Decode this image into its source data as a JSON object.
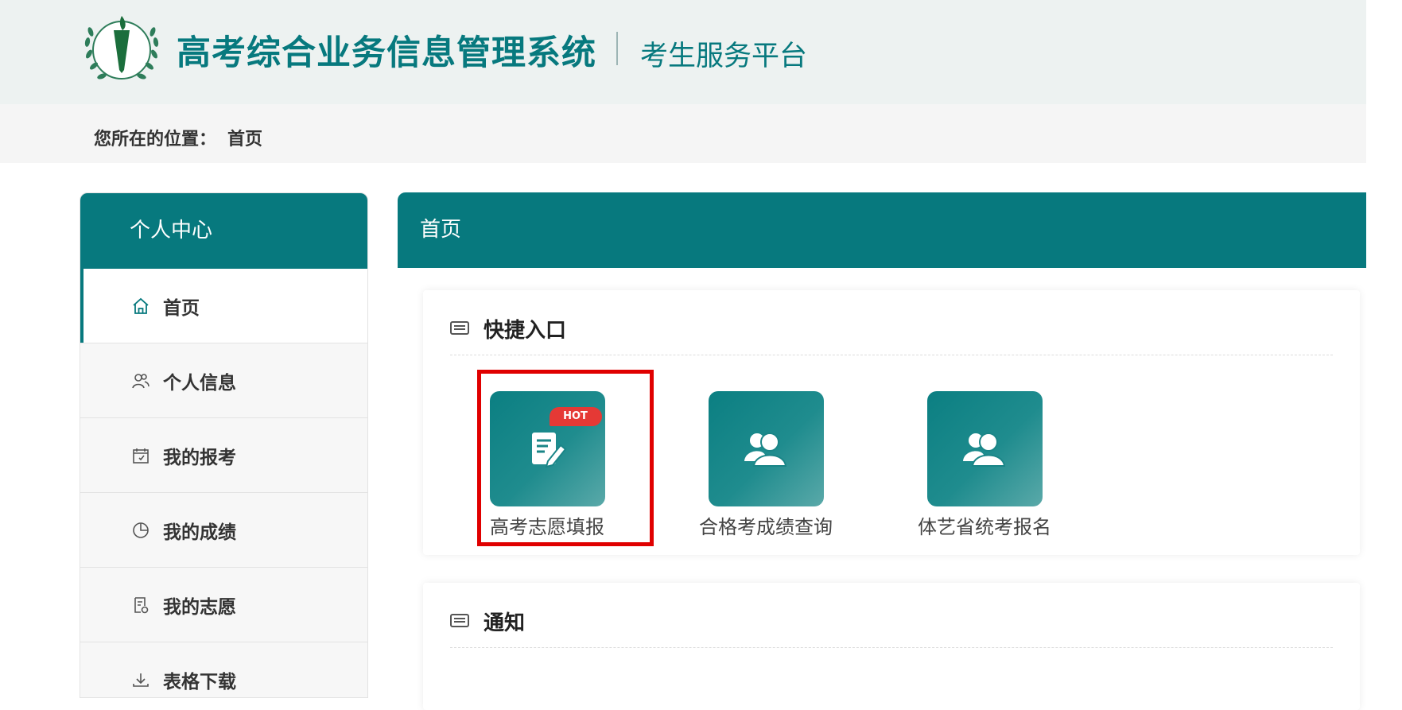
{
  "header": {
    "title": "高考综合业务信息管理系统",
    "subtitle": "考生服务平台"
  },
  "breadcrumb": {
    "prefix": "您所在的位置：",
    "current": "首页"
  },
  "sidebar": {
    "heading": "个人中心",
    "items": [
      {
        "label": "首页",
        "icon": "home-icon",
        "active": true
      },
      {
        "label": "个人信息",
        "icon": "people-icon",
        "active": false
      },
      {
        "label": "我的报考",
        "icon": "calendar-check-icon",
        "active": false
      },
      {
        "label": "我的成绩",
        "icon": "pie-chart-icon",
        "active": false
      },
      {
        "label": "我的志愿",
        "icon": "document-icon",
        "active": false
      },
      {
        "label": "表格下载",
        "icon": "download-icon",
        "active": false
      }
    ]
  },
  "main": {
    "heading": "首页",
    "quick_entry": {
      "title": "快捷入口",
      "items": [
        {
          "label": "高考志愿填报",
          "icon": "edit-document-icon",
          "badge": "HOT"
        },
        {
          "label": "合格考成绩查询",
          "icon": "users-icon"
        },
        {
          "label": "体艺省统考报名",
          "icon": "users-icon"
        }
      ]
    },
    "notice": {
      "title": "通知"
    }
  },
  "colors": {
    "primary": "#07797e",
    "highlight": "#e00000",
    "hot_badge": "#e53935"
  }
}
